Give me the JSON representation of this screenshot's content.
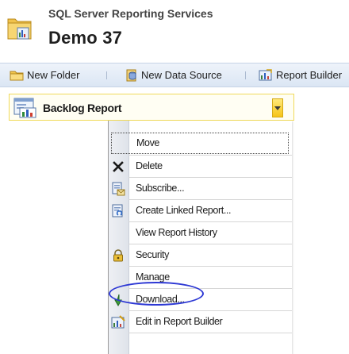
{
  "header": {
    "app_title": "SQL Server Reporting Services",
    "page_title": "Demo 37"
  },
  "toolbar": {
    "new_folder": "New Folder",
    "new_data_source": "New Data Source",
    "report_builder": "Report Builder"
  },
  "item": {
    "name": "Backlog Report"
  },
  "menu": {
    "items": [
      {
        "label": "Move",
        "icon": "none"
      },
      {
        "label": "Delete",
        "icon": "close-icon"
      },
      {
        "label": "Subscribe...",
        "icon": "subscribe-icon"
      },
      {
        "label": "Create Linked Report...",
        "icon": "linked-report-icon"
      },
      {
        "label": "View Report History",
        "icon": "none"
      },
      {
        "label": "Security",
        "icon": "lock-icon"
      },
      {
        "label": "Manage",
        "icon": "none"
      },
      {
        "label": "Download...",
        "icon": "download-icon"
      },
      {
        "label": "Edit in Report Builder",
        "icon": "report-builder-icon"
      }
    ]
  },
  "colors": {
    "tile_border": "#f0da5a",
    "highlight_circle": "#2d38d4",
    "toolbar_bg": "#dbe6f4"
  }
}
